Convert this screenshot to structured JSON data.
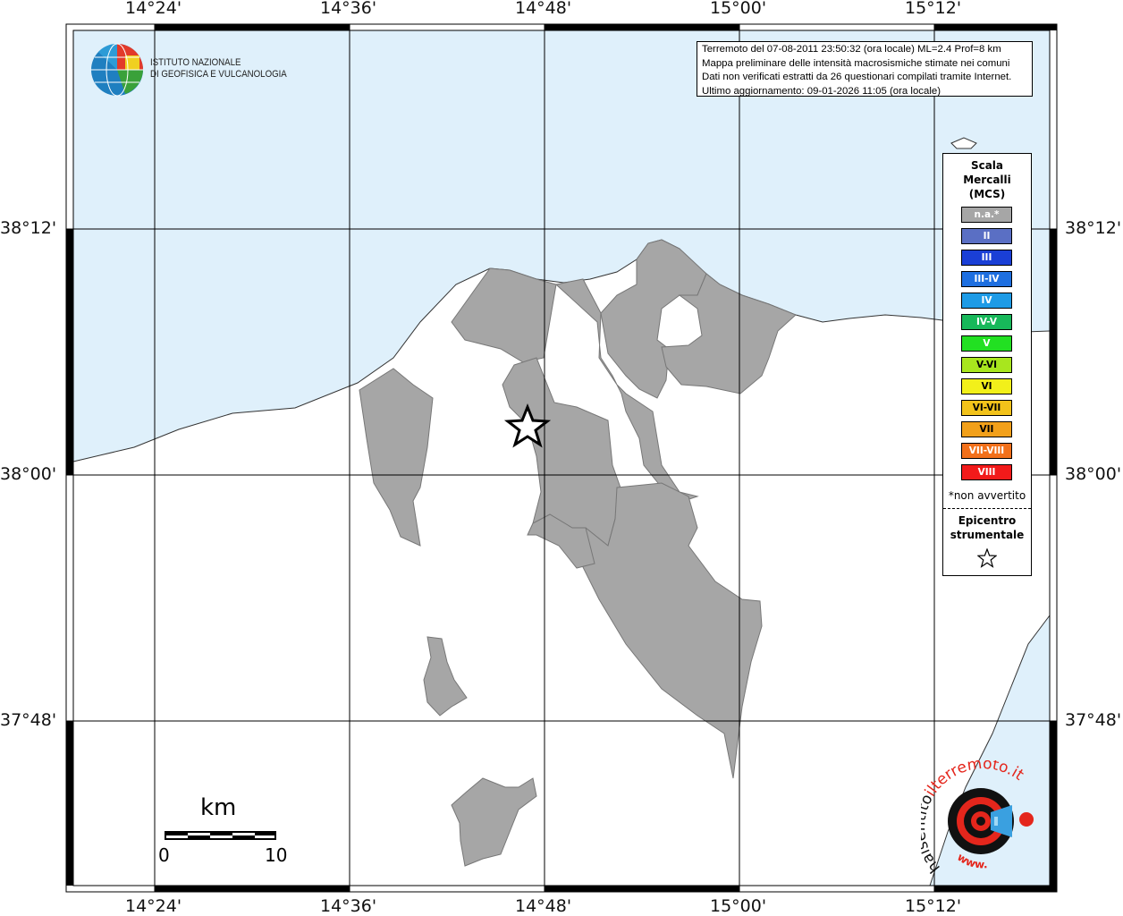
{
  "logo": {
    "line1": "ISTITUTO NAZIONALE",
    "line2": "DI GEOFISICA E VULCANOLOGIA"
  },
  "info": {
    "line1": "Terremoto del 07-08-2011 23:50:32 (ora locale) ML=2.4 Prof=8 km",
    "line2": "Mappa preliminare delle intensità macrosismiche stimate nei comuni",
    "line3": "Dati non verificati estratti da 26 questionari compilati tramite Internet.",
    "line4": "Ultimo aggiornamento: 09-01-2026 11:05 (ora locale)"
  },
  "axes": {
    "top": [
      "14°24'",
      "14°36'",
      "14°48'",
      "15°00'",
      "15°12'"
    ],
    "bottom": [
      "14°24'",
      "14°36'",
      "14°48'",
      "15°00'",
      "15°12'"
    ],
    "left": [
      "38°12'",
      "38°00'",
      "37°48'"
    ],
    "right": [
      "38°12'",
      "38°00'",
      "37°48'"
    ]
  },
  "legend": {
    "title1": "Scala",
    "title2": "Mercalli",
    "title3": "(MCS)",
    "items": [
      {
        "label": "n.a.*",
        "color": "#a6a6a6"
      },
      {
        "label": "II",
        "color": "#5a6fc4"
      },
      {
        "label": "III",
        "color": "#1a3fd6"
      },
      {
        "label": "III-IV",
        "color": "#1e6fe0"
      },
      {
        "label": "IV",
        "color": "#1e9be6"
      },
      {
        "label": "IV-V",
        "color": "#17b85a"
      },
      {
        "label": "V",
        "color": "#22e022"
      },
      {
        "label": "V-VI",
        "color": "#a8e61e"
      },
      {
        "label": "VI",
        "color": "#f2f01a"
      },
      {
        "label": "VI-VII",
        "color": "#f2c21a"
      },
      {
        "label": "VII",
        "color": "#f2a01a"
      },
      {
        "label": "VII-VIII",
        "color": "#f2701a"
      },
      {
        "label": "VIII",
        "color": "#f21a1a"
      }
    ],
    "note": "*non avvertito",
    "epicentre1": "Epicentro",
    "epicentre2": "strumentale"
  },
  "scalebar": {
    "unit": "km",
    "min": "0",
    "max": "10"
  },
  "watermark": {
    "text1": "haisentito",
    "text2": "ilterremoto.it",
    "text3": "www."
  },
  "colors": {
    "sea": "#dff0fb",
    "municipality": "#a6a6a6",
    "frame": "#000000"
  }
}
